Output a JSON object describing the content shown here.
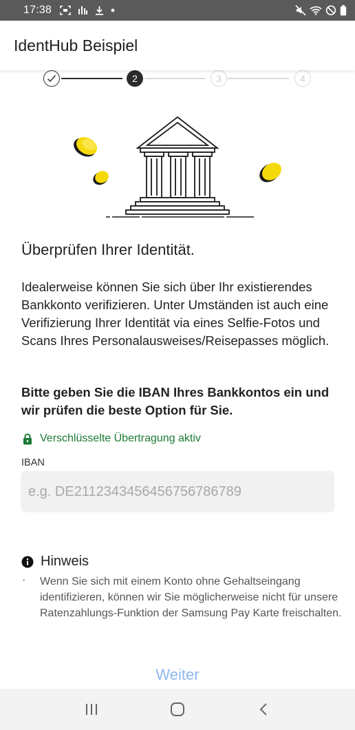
{
  "status_bar": {
    "time": "17:38",
    "left_icons": [
      "screenshot-icon",
      "signal-bars-icon",
      "download-icon",
      "dot-icon"
    ],
    "right_icons": [
      "mute-icon",
      "wifi-icon",
      "do-not-disturb-icon",
      "battery-icon"
    ]
  },
  "app_bar": {
    "title": "IdentHub Beispiel"
  },
  "stepper": {
    "steps": [
      {
        "label": "",
        "state": "completed"
      },
      {
        "label": "2",
        "state": "active"
      },
      {
        "label": "3",
        "state": "inactive"
      },
      {
        "label": "4",
        "state": "inactive"
      }
    ]
  },
  "main": {
    "heading": "Überprüfen Ihrer Identität.",
    "body": "Idealerweise können Sie sich über Ihr existierendes Bankkonto verifizieren. Unter Umständen ist auch eine Verifizierung Ihrer Identität via eines Selfie-Fotos und Scans Ihres Personalausweises/Reisepasses möglich.",
    "bold_text": "Bitte geben Sie die IBAN Ihres Bankkontos ein und wir prüfen die beste Option für Sie.",
    "secure_label": "Verschlüsselte Übertragung aktiv",
    "iban_label": "IBAN",
    "iban_placeholder": "e.g. DE2112343456456756786789",
    "iban_value": ""
  },
  "hint": {
    "title": "Hinweis",
    "bullet": "·",
    "text": "Wenn Sie sich mit einem Konto ohne Gehaltseingang identifizieren, können wir Sie möglicherweise nicht für unsere Ratenzahlungs-Funktion der Samsung Pay Karte freischalten."
  },
  "actions": {
    "next_label": "Weiter"
  },
  "nav_bar": {
    "buttons": [
      "recent-apps-icon",
      "home-icon",
      "back-icon"
    ]
  },
  "colors": {
    "accent_yellow": "#F5D90A",
    "secure_green": "#1B7A34",
    "button_disabled_blue": "#8FB7EC",
    "step_active": "#2B2B2B",
    "step_inactive": "#DADADA"
  }
}
